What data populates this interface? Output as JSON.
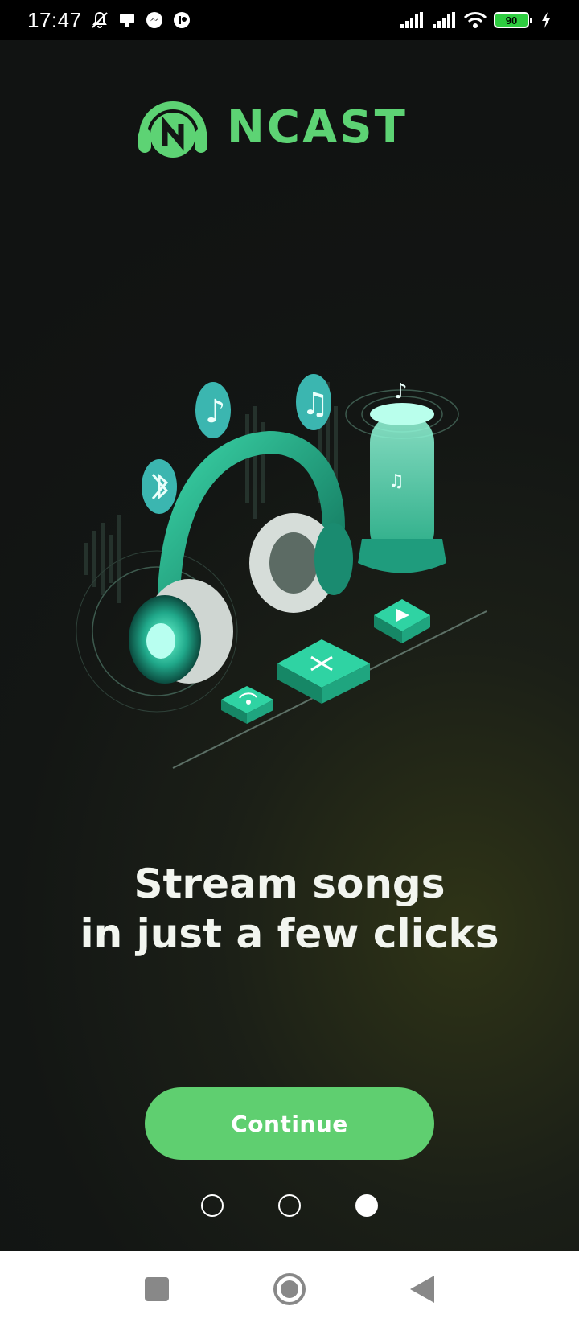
{
  "status_bar": {
    "time": "17:47",
    "battery_level": "90",
    "icons_left": [
      "mute-bell-icon",
      "notification-icon",
      "messenger-icon",
      "app-icon"
    ],
    "icons_right": [
      "signal-icon",
      "signal-icon",
      "wifi-icon",
      "battery-icon",
      "charging-icon"
    ]
  },
  "app": {
    "logo_text": "NCAST",
    "brand_color": "#5dd374"
  },
  "onboarding": {
    "headline_line1": "Stream songs",
    "headline_line2": "in just a few clicks",
    "continue_label": "Continue",
    "page_count": 3,
    "current_page": 3
  },
  "nav_bar": {
    "buttons": [
      "recents-square-icon",
      "home-circle-icon",
      "back-triangle-icon"
    ]
  }
}
